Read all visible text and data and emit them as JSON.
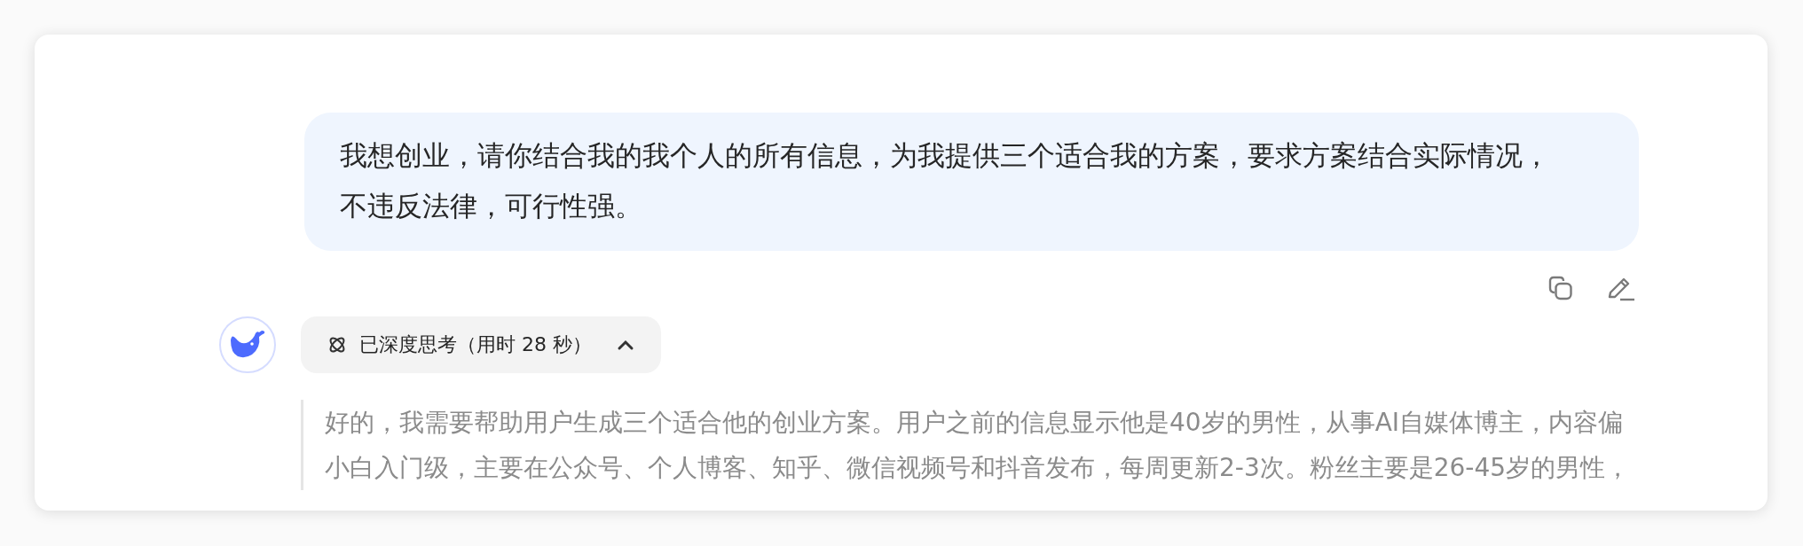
{
  "user_message": {
    "lines": [
      "我想创业，请你结合我的我个人的所有信息，为我提供三个适合我的方案，要求方案结合实际情况，",
      "不违反法律，可行性强。"
    ]
  },
  "message_actions": [
    {
      "kind": "copy"
    },
    {
      "kind": "edit"
    }
  ],
  "thinking_toggle": {
    "label": "已深度思考（用时 28 秒）",
    "expanded": true
  },
  "reasoning": {
    "lines": [
      "好的，我需要帮助用户生成三个适合他的创业方案。用户之前的信息显示他是40岁的男性，从事AI自媒体博主，内容偏",
      "小白入门级，主要在公众号、个人博客、知乎、微信视频号和抖音发布，每周更新2-3次。粉丝主要是26-45岁的男性，"
    ]
  }
}
